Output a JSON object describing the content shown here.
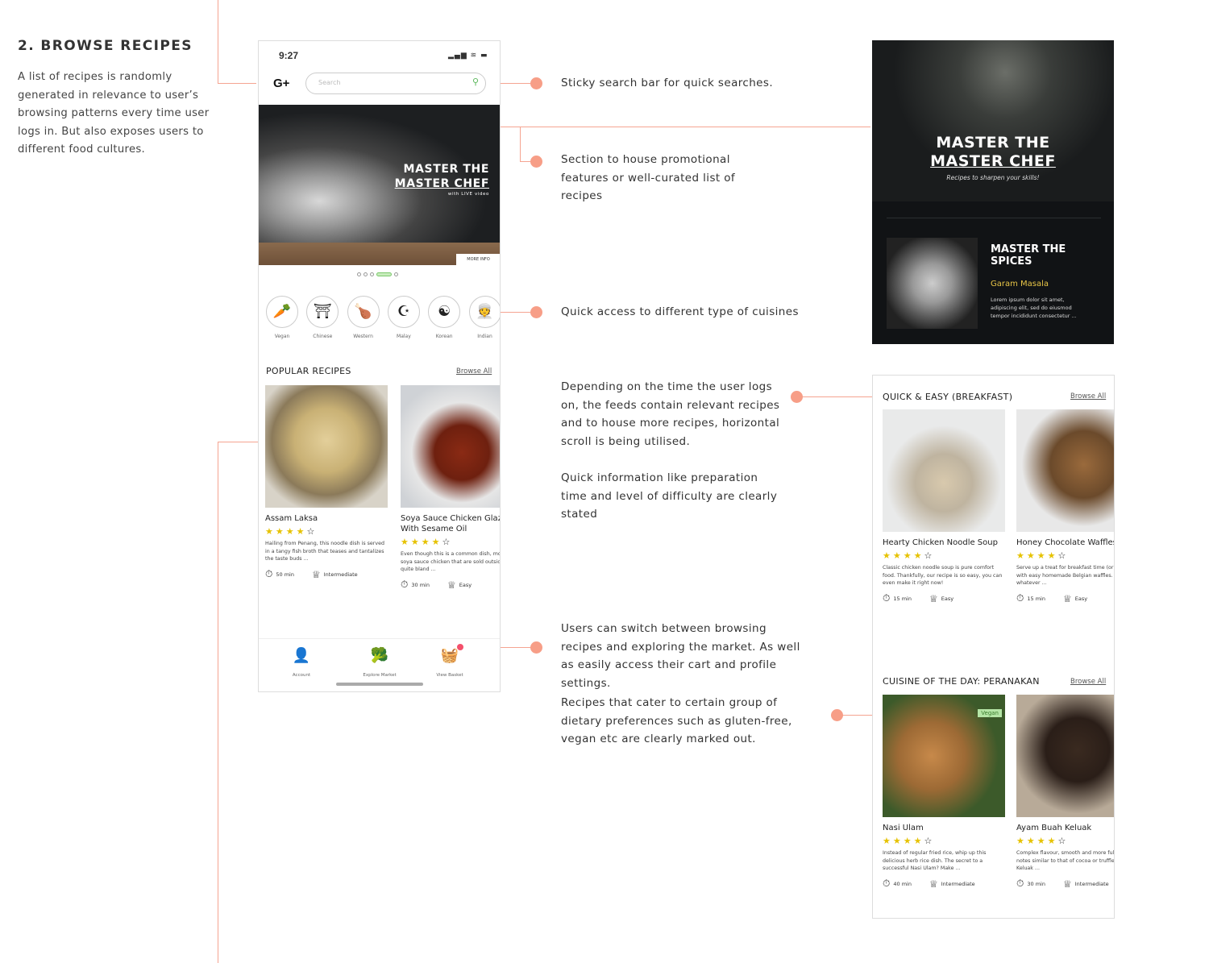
{
  "colors": {
    "accent": "#f79e87",
    "star": "#e6c200",
    "garam": "#e8c547",
    "vegan_tag": "#b5e5a6"
  },
  "section": {
    "title": "2. BROWSE RECIPES",
    "intro": "A list of recipes is randomly generated in relevance to user’s browsing patterns every time user logs in. But also exposes users to different food cultures."
  },
  "annotations": [
    "Sticky search bar for quick searches.",
    "Section to house promotional features or well-curated list of recipes",
    "Quick access to different type of cuisines",
    "Depending on the time the user logs on, the feeds contain relevant recipes and to house more recipes, horizontal scroll is being utilised.",
    "Quick information like preparation time and level of difficulty are clearly stated",
    "Users can switch between browsing recipes and exploring the market. As well as easily access their cart and profile settings.",
    "Recipes that cater to certain group of dietary preferences such as gluten-free, vegan etc are clearly marked out."
  ],
  "phone": {
    "time": "9:27",
    "logo": "G+",
    "search_placeholder": "Search",
    "banner": {
      "line1": "MASTER THE",
      "line2": "MASTER CHEF",
      "sub": "with LIVE video",
      "more": "MORE INFO",
      "pages": 5,
      "active_page": 4
    },
    "categories": [
      {
        "label": "Vegan",
        "icon": "carrot-icon",
        "glyph": "🥕"
      },
      {
        "label": "Chinese",
        "icon": "pagoda-icon",
        "glyph": "⛩"
      },
      {
        "label": "Western",
        "icon": "drumstick-icon",
        "glyph": "🍗"
      },
      {
        "label": "Malay",
        "icon": "crescent-icon",
        "glyph": "☪"
      },
      {
        "label": "Korean",
        "icon": "korean-flag-icon",
        "glyph": "☯"
      },
      {
        "label": "Indian",
        "icon": "indian-person-icon",
        "glyph": "👳"
      }
    ],
    "popular": {
      "title": "POPULAR RECIPES",
      "browse": "Browse All",
      "recipes": [
        {
          "title": "Assam Laksa",
          "rating": 4,
          "desc": "Hailing from Penang, this noodle dish is served in a tangy fish broth that teases and tantalizes the taste buds ...",
          "time": "50 min",
          "level": "Intermediate"
        },
        {
          "title": "Soya Sauce Chicken Glaze With Sesame Oil",
          "rating": 4,
          "desc": "Even though this is a common dish, most of the soya sauce chicken that are sold outside are quite bland ...",
          "time": "30 min",
          "level": "Easy"
        }
      ]
    },
    "nav": [
      {
        "label": "Account",
        "icon": "account-icon",
        "glyph": "👤"
      },
      {
        "label": "Explore Market",
        "icon": "broccoli-icon",
        "glyph": "🥦"
      },
      {
        "label": "View Basket",
        "icon": "basket-icon",
        "glyph": "🧺"
      }
    ]
  },
  "promo": {
    "line1": "MASTER THE",
    "line2": "MASTER CHEF",
    "sub": "Recipes to sharpen your skills!",
    "feature": {
      "title1": "MASTER THE",
      "title2": "SPICES",
      "name": "Garam Masala",
      "desc": "Lorem ipsum dolor sit amet, adipiscing elit, sed do eiusmod tempor incididunt consectetur ..."
    }
  },
  "feeds": [
    {
      "title": "QUICK & EASY (BREAKFAST)",
      "browse": "Browse All",
      "recipes": [
        {
          "title": "Hearty Chicken Noodle Soup",
          "rating": 4,
          "desc": "Classic chicken noodle soup is pure comfort food. Thankfully, our recipe is so easy, you can even make it right now!",
          "time": "15 min",
          "level": "Easy"
        },
        {
          "title": "Honey Chocolate Waffles",
          "rating": 4,
          "desc": "Serve up a treat for breakfast time (or dessert) with easy homemade Belgian waffles. Top with whatever ...",
          "time": "15 min",
          "level": "Easy"
        }
      ]
    },
    {
      "title": "CUISINE OF THE DAY: PERANAKAN",
      "browse": "Browse All",
      "recipes": [
        {
          "title": "Nasi Ulam",
          "rating": 4,
          "tag": "Vegan",
          "desc": "Instead of regular fried rice, whip up this delicious herb rice dish. The secret to a successful Nasi Ulam? Make ...",
          "time": "40 min",
          "level": "Intermediate"
        },
        {
          "title": "Ayam Buah Keluak",
          "rating": 4,
          "desc": "Complex flavour, smooth and more full-bodied notes similar to that of cocoa or truffle, the Buah Keluak ...",
          "time": "30 min",
          "level": "Intermediate"
        }
      ]
    }
  ]
}
